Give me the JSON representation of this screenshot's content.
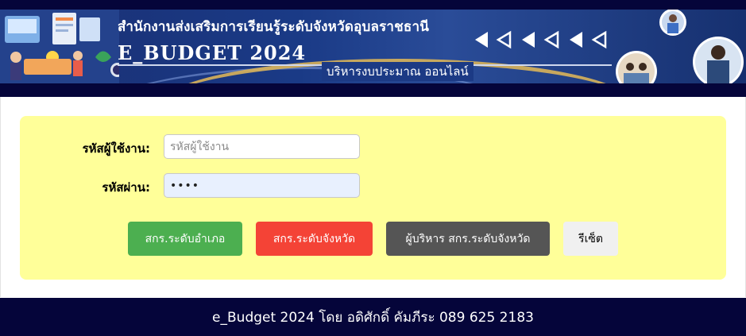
{
  "banner": {
    "org_title": "สำนักงานส่งเสริมการเรียนรู้ระดับจังหวัดอุบลราชธานี",
    "app_title": "E_BUDGET 2024",
    "subtitle": "บริหารงบประมาณ ออนไลน์"
  },
  "login": {
    "username_label": "รหัสผู้ใช้งาน:",
    "username_placeholder": "รหัสผู้ใช้งาน",
    "username_value": "",
    "password_label": "รหัสผ่าน:",
    "password_value": "••••"
  },
  "buttons": {
    "district": "สกร.ระดับอำเภอ",
    "province": "สกร.ระดับจังหวัด",
    "executive": "ผู้บริหาร สกร.ระดับจังหวัด",
    "reset": "รีเซ็ต"
  },
  "footer": {
    "text": "e_Budget 2024 โดย อดิศักดิ์ คัมภีระ 089 625 2183"
  },
  "colors": {
    "header_bg": "#05053a",
    "panel_bg": "#ffff99",
    "district_button": "#4caf50",
    "province_button": "#f44336",
    "executive_button": "#555555",
    "reset_button": "#f0f0f0"
  }
}
